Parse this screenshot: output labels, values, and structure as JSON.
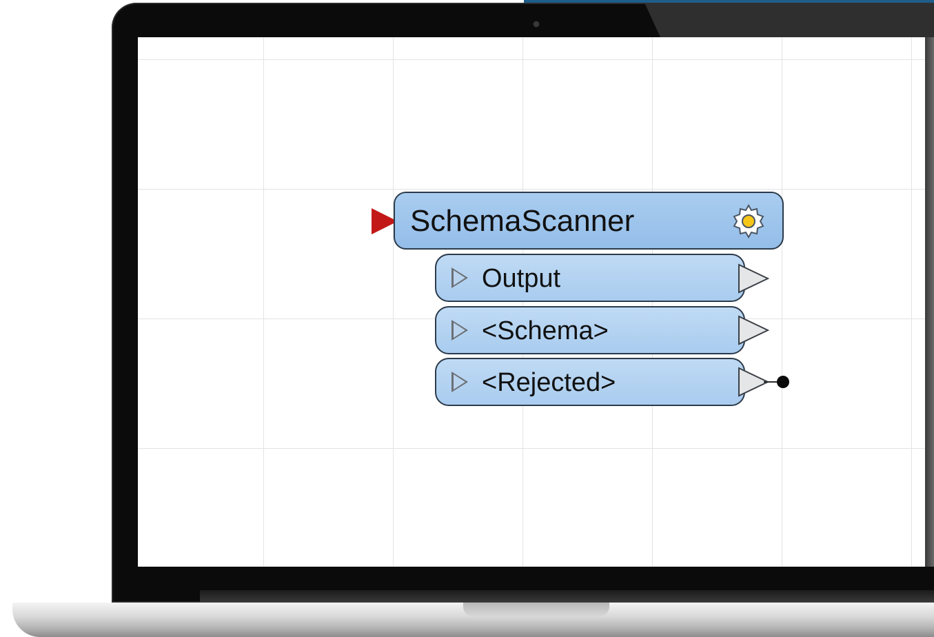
{
  "colors": {
    "input_port": "#c21818",
    "header_fill": "#94bde8",
    "row_fill": "#a9ccef",
    "outline": "#2b3a4a",
    "gear": "#f5c518"
  },
  "transformer": {
    "title": "SchemaScanner",
    "settings_icon": "gear-icon",
    "ports": [
      {
        "label": "Output"
      },
      {
        "label": "<Schema>"
      },
      {
        "label": "<Rejected>"
      }
    ]
  }
}
